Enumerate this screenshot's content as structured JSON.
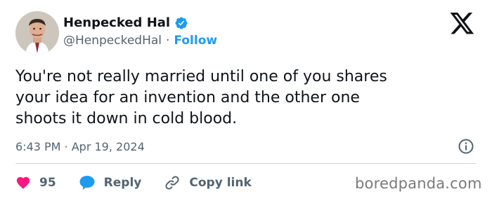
{
  "author": {
    "display_name": "Henpecked Hal",
    "handle": "@HenpeckedHal",
    "separator": "·",
    "follow_label": "Follow",
    "verified": true
  },
  "tweet": {
    "text": "You're not really married until one of you shares\nyour idea for an invention and the other one\nshoots it down in cold blood.",
    "time": "6:43 PM · Apr 19, 2024"
  },
  "actions": {
    "likes_count": "95",
    "reply_label": "Reply",
    "copy_link_label": "Copy link"
  },
  "icons": {
    "platform_logo": "x-logo-icon",
    "verified": "verified-badge-icon",
    "info": "info-icon",
    "like": "heart-icon",
    "reply": "reply-bubble-icon",
    "copy": "link-icon"
  },
  "colors": {
    "accent": "#1d9bf0",
    "like": "#f91880",
    "text": "#0f1419",
    "muted": "#536471"
  },
  "watermark": "boredpanda.com"
}
